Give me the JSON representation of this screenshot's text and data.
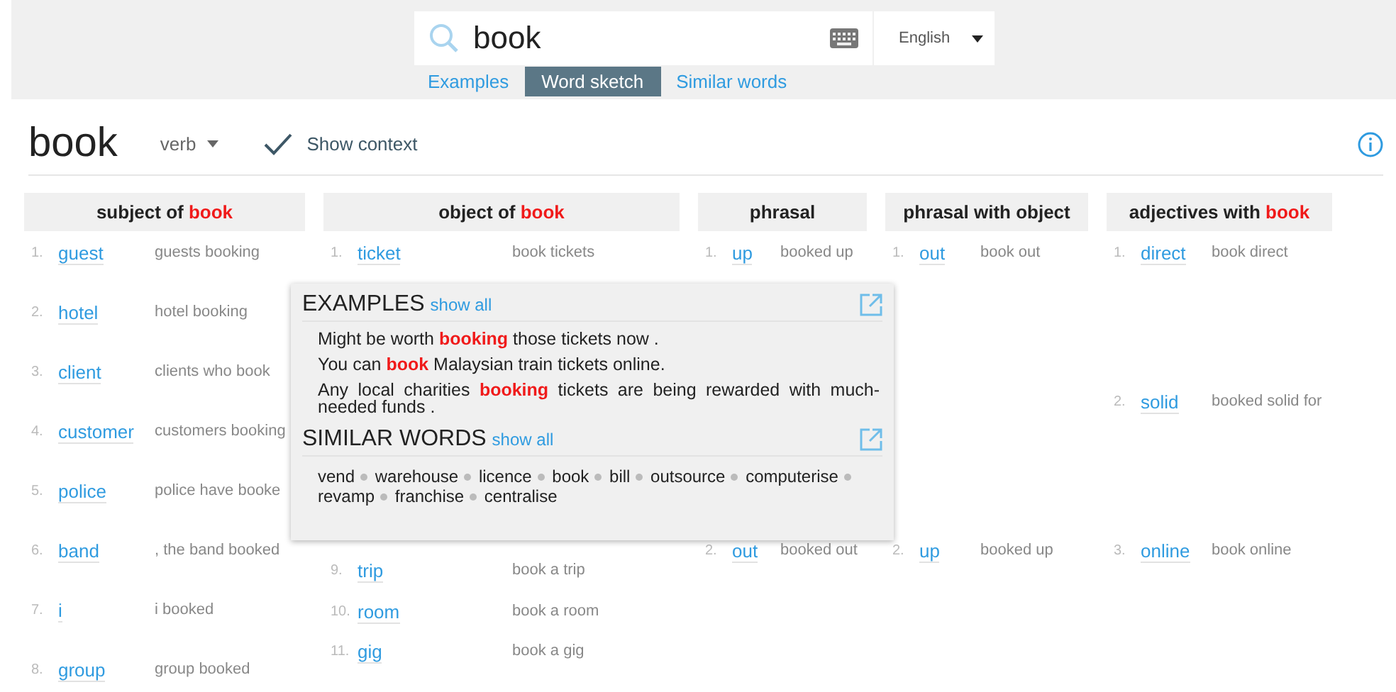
{
  "search": {
    "value": "book",
    "language": "English"
  },
  "tabs": [
    {
      "label": "Examples",
      "selected": false
    },
    {
      "label": "Word sketch",
      "selected": true
    },
    {
      "label": "Similar words",
      "selected": false
    }
  ],
  "headword": "book",
  "pos": "verb",
  "show_context": {
    "label": "Show context",
    "checked": true
  },
  "columns": [
    {
      "title": "subject of",
      "headword": "book",
      "items": [
        {
          "number": "1.",
          "word": "guest",
          "context": "guests booking"
        },
        {
          "number": "2.",
          "word": "hotel",
          "context": "hotel booking"
        },
        {
          "number": "3.",
          "word": "client",
          "context": "clients who book"
        },
        {
          "number": "4.",
          "word": "customer",
          "context": "customers booking"
        },
        {
          "number": "5.",
          "word": "police",
          "context": "police have booke"
        },
        {
          "number": "6.",
          "word": "band",
          "context": ", the band booked"
        },
        {
          "number": "7.",
          "word": "i",
          "context": "i booked"
        },
        {
          "number": "8.",
          "word": "group",
          "context": "group booked"
        }
      ]
    },
    {
      "title": "object of",
      "headword": "book",
      "items": [
        {
          "number": "1.",
          "word": "ticket",
          "context": "book tickets"
        },
        {
          "number": "9.",
          "word": "trip",
          "context": "book a trip"
        },
        {
          "number": "10.",
          "word": "room",
          "context": "book a room"
        },
        {
          "number": "11.",
          "word": "gig",
          "context": "book a gig"
        }
      ]
    },
    {
      "title": "phrasal",
      "items": [
        {
          "number": "1.",
          "word": "up",
          "context": "booked up"
        },
        {
          "number": "2.",
          "word": "out",
          "context": "booked out"
        }
      ]
    },
    {
      "title": "phrasal with object",
      "items": [
        {
          "number": "1.",
          "word": "out",
          "context": "book out"
        },
        {
          "number": "2.",
          "word": "up",
          "context": "booked up"
        }
      ]
    },
    {
      "title": "adjectives with",
      "headword": "book",
      "items": [
        {
          "number": "1.",
          "word": "direct",
          "context": "book direct"
        },
        {
          "number": "2.",
          "word": "solid",
          "context": "booked solid for"
        },
        {
          "number": "3.",
          "word": "online",
          "context": "book online"
        }
      ]
    }
  ],
  "popup": {
    "examples": {
      "title": "EXAMPLES",
      "link": "show all",
      "sentences": [
        "Might be worth **booking** those tickets now .",
        "You can **book** Malaysian train tickets online.",
        "Any local charities **booking** tickets are being rewarded with much-needed funds ."
      ]
    },
    "similar": {
      "title": "SIMILAR WORDS",
      "link": "show all",
      "words": [
        "vend",
        "warehouse",
        "licence",
        "book",
        "bill",
        "outsource",
        "computerise",
        "revamp",
        "franchise",
        "centralise"
      ]
    }
  }
}
